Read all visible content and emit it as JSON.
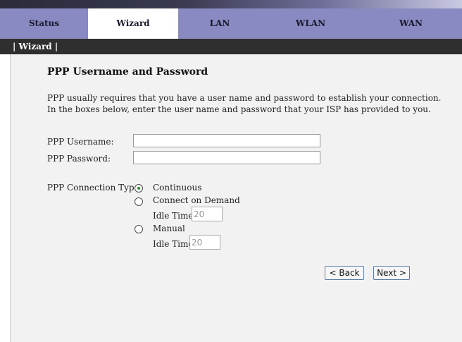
{
  "tabs": [
    {
      "label": "Status"
    },
    {
      "label": "Wizard"
    },
    {
      "label": "LAN"
    },
    {
      "label": "WLAN"
    },
    {
      "label": "WAN"
    }
  ],
  "subnav": {
    "label": "| Wizard |"
  },
  "page": {
    "title": "PPP Username and Password",
    "desc_line1": "PPP usually requires that you have a user name and password to establish your connection.",
    "desc_line2": "In the boxes below, enter the user name and password that your ISP has provided to you."
  },
  "form": {
    "username_label": "PPP Username:",
    "username_value": "",
    "password_label": "PPP Password:",
    "password_value": "",
    "conn_type_label": "PPP Connection Type:",
    "options": [
      {
        "label": "Continuous",
        "checked": true
      },
      {
        "label": "Connect on Demand",
        "checked": false
      },
      {
        "label": "Manual",
        "checked": false
      }
    ],
    "idle_time_label_1": "Idle Time:",
    "idle_time_value_1": "20",
    "idle_time_label_2": "Idle Time",
    "idle_time_value_2": "20"
  },
  "buttons": {
    "back": "< Back",
    "next": "Next >"
  }
}
